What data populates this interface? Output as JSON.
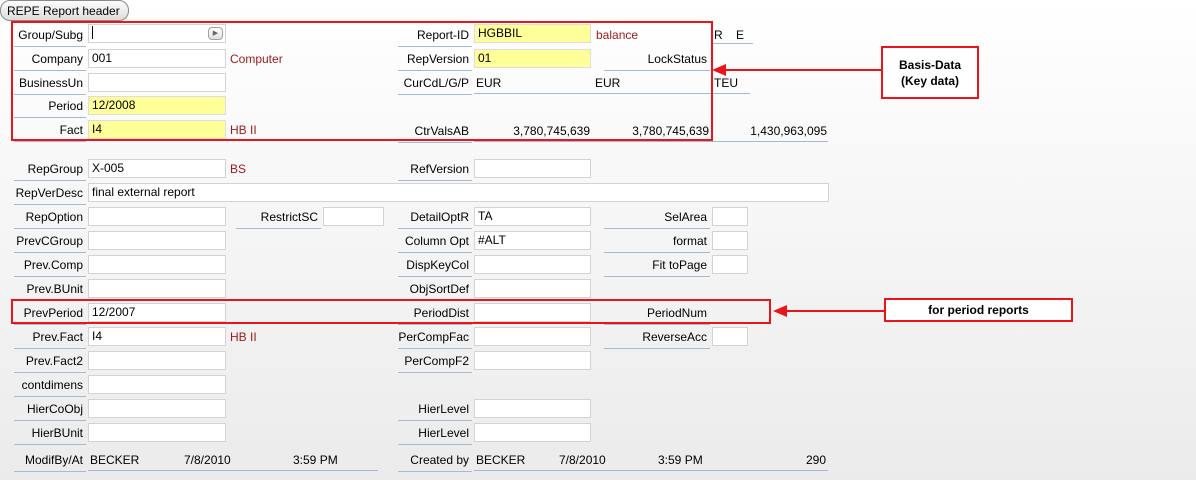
{
  "tab": {
    "title": "REPE Report header"
  },
  "callouts": {
    "basis": "Basis-Data\n(Key data)",
    "period": "for period reports"
  },
  "labels": {
    "group_subg": "Group/Subg",
    "company": "Company",
    "business_un": "BusinessUn",
    "period": "Period",
    "fact": "Fact",
    "report_id": "Report-ID",
    "rep_version": "RepVersion",
    "lock_status": "LockStatus",
    "cur_cdl": "CurCdL/G/P",
    "ctr_vals": "CtrValsAB",
    "rep_group": "RepGroup",
    "ref_version": "RefVersion",
    "rep_ver_desc": "RepVerDesc",
    "rep_option": "RepOption",
    "restrict_sc": "RestrictSC",
    "detail_optr": "DetailOptR",
    "sel_area": "SelArea",
    "prev_cgroup": "PrevCGroup",
    "column_opt": "Column Opt",
    "format": "format",
    "prev_comp": "Prev.Comp",
    "disp_key_col": "DispKeyCol",
    "fit_to_page": "Fit toPage",
    "prev_bunit": "Prev.BUnit",
    "obj_sort_def": "ObjSortDef",
    "prev_period": "PrevPeriod",
    "period_dist": "PeriodDist",
    "period_num": "PeriodNum",
    "prev_fact": "Prev.Fact",
    "per_comp_fac": "PerCompFac",
    "reverse_acc": "ReverseAcc",
    "prev_fact2": "Prev.Fact2",
    "per_comp_f2": "PerCompF2",
    "contdimens": "contdimens",
    "hier_co_obj": "HierCoObj",
    "hier_level_1": "HierLevel",
    "hier_bunit": "HierBUnit",
    "hier_level_2": "HierLevel",
    "modif_by_at": "ModifBy/At",
    "created_by": "Created by"
  },
  "values": {
    "group_subg": "",
    "company": "001",
    "company_desc": "Computer",
    "business_un": "",
    "period": "12/2008",
    "fact": "I4",
    "fact_desc": "HB II",
    "report_id": "HGBBIL",
    "report_id_desc": "balance",
    "report_flag_r": "R",
    "report_flag_e": "E",
    "rep_version": "01",
    "lock_status": "",
    "cur_local": "EUR",
    "cur_group": "EUR",
    "cur_parent": "TEU",
    "ctr_val_a": "3,780,745,639",
    "ctr_val_b": "3,780,745,639",
    "ctr_val_c": "1,430,963,095",
    "rep_group": "X-005",
    "rep_group_desc": "BS",
    "ref_version": "",
    "rep_ver_desc": "final external report",
    "rep_option": "",
    "restrict_sc": "",
    "detail_optr": "TA",
    "sel_area": "",
    "prev_cgroup": "",
    "column_opt": "#ALT",
    "format": "",
    "prev_comp": "",
    "disp_key_col": "",
    "fit_to_page": "",
    "prev_bunit": "",
    "obj_sort_def": "",
    "prev_period": "12/2007",
    "period_dist": "",
    "period_num": "",
    "prev_fact": "I4",
    "prev_fact_desc": "HB II",
    "per_comp_fac": "",
    "reverse_acc": "",
    "prev_fact2": "",
    "per_comp_f2": "",
    "contdimens": "",
    "hier_co_obj": "",
    "hier_level_1": "",
    "hier_bunit": "",
    "hier_level_2": "",
    "modif_user": "BECKER",
    "modif_date": "7/8/2010",
    "modif_time": "3:59 PM",
    "created_user": "BECKER",
    "created_date": "7/8/2010",
    "created_time": "3:59 PM",
    "created_num": "290"
  },
  "colors": {
    "highlight": "#ffff99",
    "annotation_red": "#e8151b",
    "desc_text": "#9a1a1a"
  }
}
